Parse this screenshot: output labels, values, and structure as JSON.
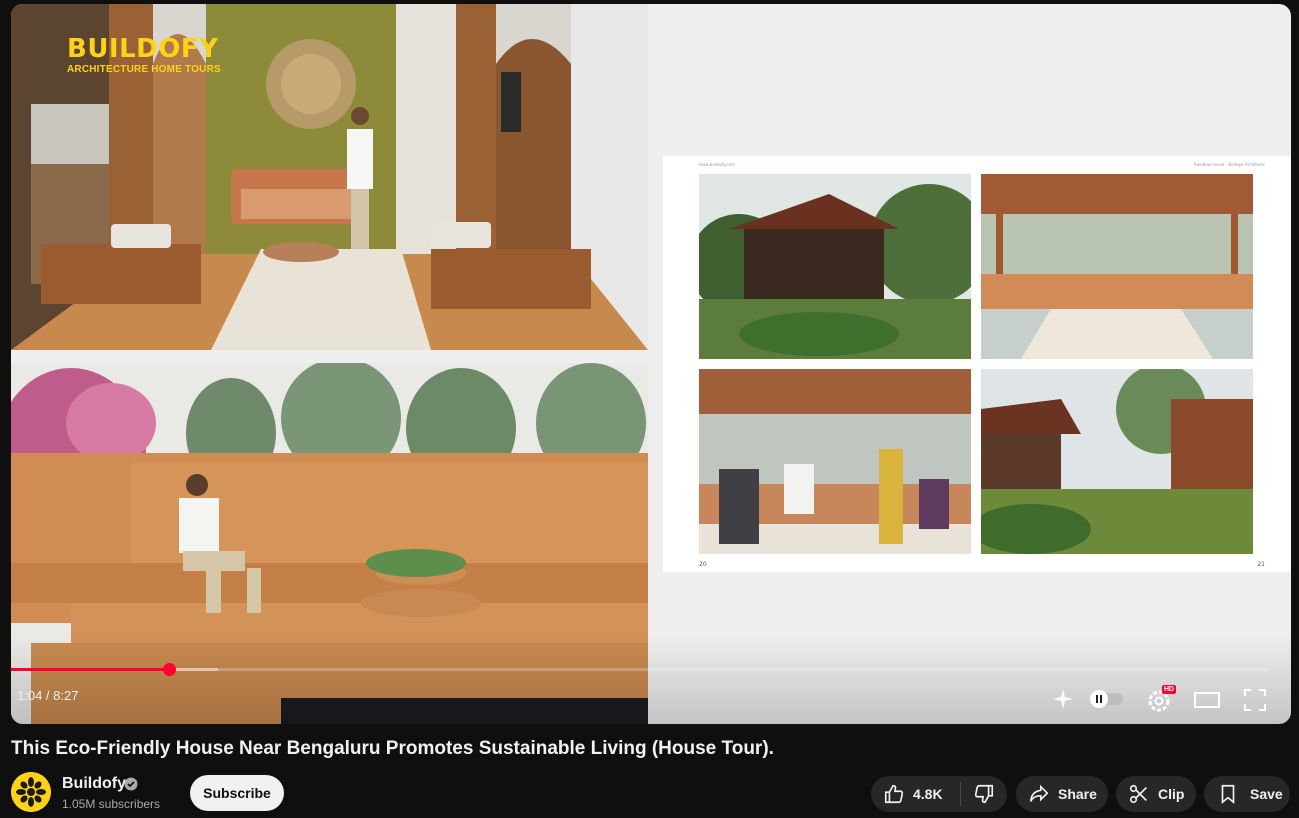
{
  "player": {
    "logo_word": "BUILDOFY",
    "logo_sub": "ARCHITECTURE HOME TOURS",
    "current_time": "1:04",
    "duration": "8:27",
    "time_display": "1:04 / 8:27",
    "progress_fraction": 0.126,
    "buffer_fraction": 0.165,
    "hd_badge": "HD",
    "brochure": {
      "header_left": "www.buildofy.com",
      "header_right": "Rainbow house - Biotope Architects",
      "page_left": "20",
      "page_right": "21"
    }
  },
  "video": {
    "title": "This Eco-Friendly House Near Bengaluru Promotes Sustainable Living (House Tour)."
  },
  "channel": {
    "name": "Buildofy",
    "subscribers": "1.05M subscribers",
    "subscribe_label": "Subscribe"
  },
  "actions": {
    "like_count": "4.8K",
    "share_label": "Share",
    "clip_label": "Clip",
    "save_label": "Save"
  },
  "colors": {
    "accent": "#ff0033",
    "brand_yellow": "#ffd21a",
    "page_bg": "#0f0f0f",
    "pill_bg": "#272727"
  },
  "icons": [
    "like-icon",
    "dislike-icon",
    "share-icon",
    "clip-icon",
    "save-icon",
    "sparkle-icon",
    "autoplay-toggle-icon",
    "settings-icon",
    "theater-icon",
    "fullscreen-icon",
    "verified-icon"
  ]
}
